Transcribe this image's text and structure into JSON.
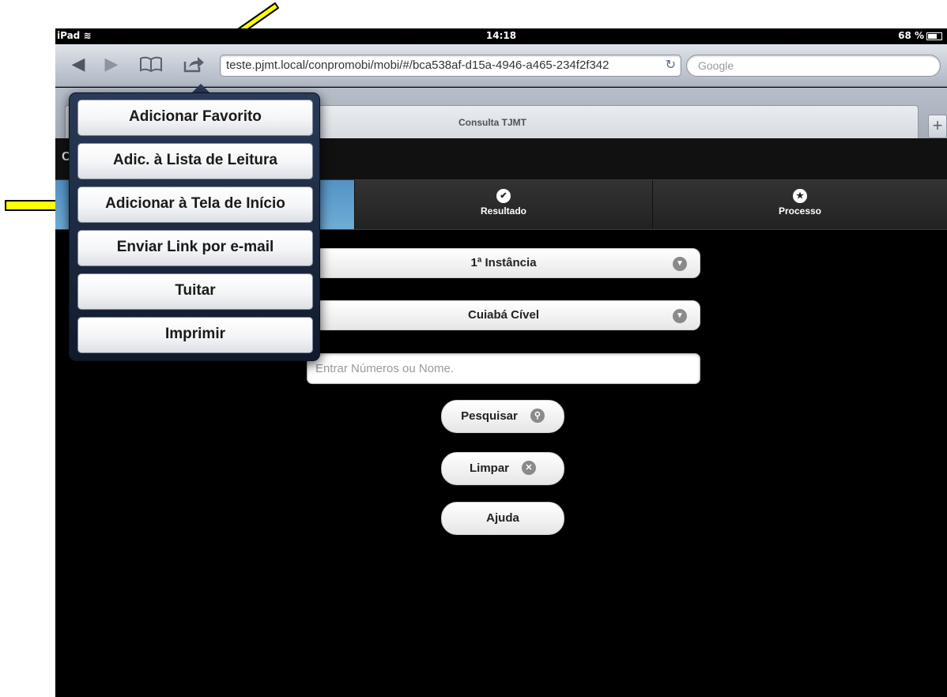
{
  "status": {
    "carrier": "iPad",
    "time": "14:18",
    "battery": "68 %"
  },
  "toolbar": {
    "url": "teste.pjmt.local/conpromobi/mobi/#/bca538af-d15a-4946-a465-234f2f342",
    "search_placeholder": "Google",
    "icons": [
      "back-icon",
      "forward-icon",
      "bookmarks-icon",
      "share-icon",
      "reload-icon"
    ]
  },
  "tabs": {
    "active_title": "Consulta TJMT",
    "add_label": "+"
  },
  "header": {
    "left_glyph": "C"
  },
  "nav": [
    {
      "label": ""
    },
    {
      "label": "Resultado",
      "icon": "check-icon"
    },
    {
      "label": "Processo",
      "icon": "star-icon"
    }
  ],
  "form": {
    "instance_select": "1ª Instância",
    "comarca_select": "Cuiabá Cível",
    "search_placeholder": "Entrar Números ou Nome.",
    "pesquisar_label": "Pesquisar",
    "limpar_label": "Limpar",
    "ajuda_label": "Ajuda"
  },
  "share_menu": {
    "items": [
      "Adicionar Favorito",
      "Adic. à Lista de Leitura",
      "Adicionar à Tela de Início",
      "Enviar Link por e-mail",
      "Tuitar",
      "Imprimir"
    ]
  },
  "colors": {
    "annotation_arrow": "#ffff00",
    "nav_active": "#5393c5",
    "popover": "#1c2a44"
  }
}
